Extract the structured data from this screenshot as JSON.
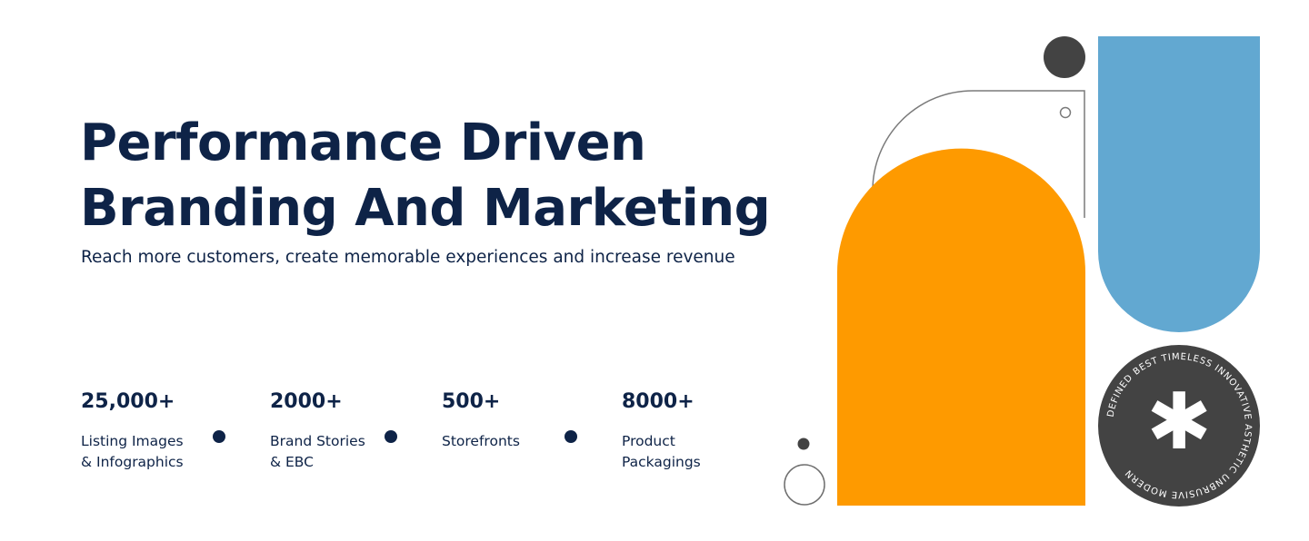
{
  "hero": {
    "title_line1": "Performance Driven",
    "title_line2": "Branding And Marketing",
    "subtitle": "Reach more customers, create memorable experiences and increase revenue"
  },
  "stats": [
    {
      "value": "25,000+",
      "label": "Listing Images\n& Infographics"
    },
    {
      "value": "2000+",
      "label": "Brand Stories\n& EBC"
    },
    {
      "value": "500+",
      "label": "Storefronts"
    },
    {
      "value": "8000+",
      "label": "Product\nPackagings"
    }
  ],
  "badge": {
    "ring_text": "DEFINED BEST TIMELESS INNOVATIVE ASTHETIC UNBRUSIVE MODERN",
    "center_glyph": "✱"
  },
  "colors": {
    "navy": "#0e2347",
    "orange": "#fe9a00",
    "blue": "#62a8d1",
    "charcoal": "#434343",
    "outline": "#7a7a7a"
  }
}
